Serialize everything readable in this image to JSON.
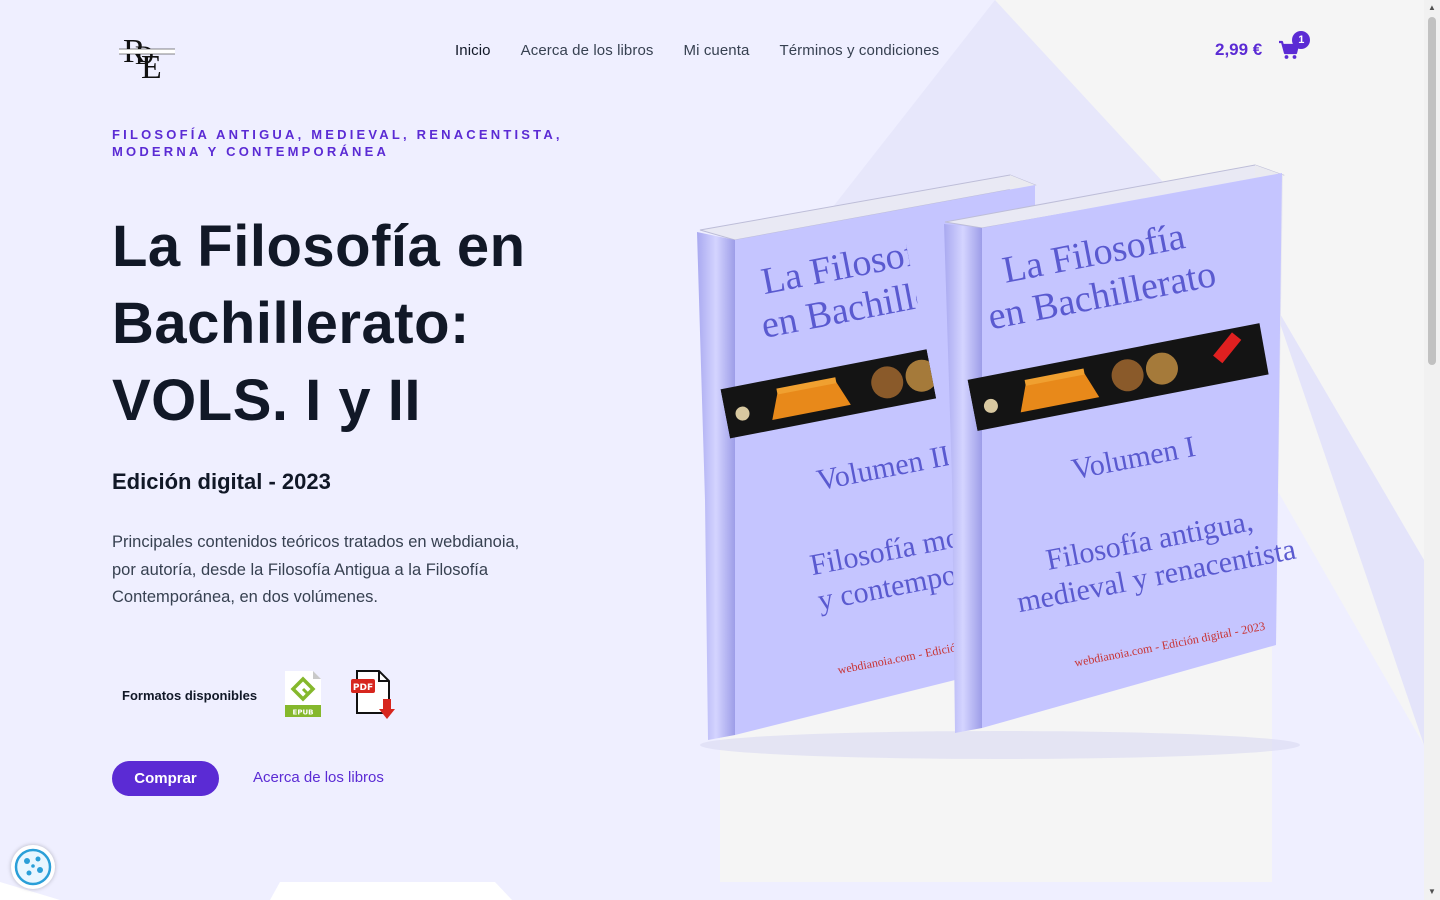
{
  "header": {
    "nav": [
      {
        "label": "Inicio",
        "active": true
      },
      {
        "label": "Acerca de los libros",
        "active": false
      },
      {
        "label": "Mi cuenta",
        "active": false
      },
      {
        "label": "Términos y condiciones",
        "active": false
      }
    ],
    "cart": {
      "total": "2,99 €",
      "count": "1",
      "icon": "cart-icon"
    },
    "logo": {
      "icon": "publisher-logo",
      "text": "RDE"
    }
  },
  "hero": {
    "eyebrow": "FILOSOFÍA ANTIGUA, MEDIEVAL, RENACENTISTA, MODERNA Y CONTEMPORÁNEA",
    "title_line1": "La Filosofía en",
    "title_line2": "Bachillerato:",
    "title_line3": "VOLS. I y II",
    "subtitle": "Edición digital - 2023",
    "description": "Principales contenidos teóricos tratados en webdianoia, por autoría, desde la Filosofía Antigua a la Filosofía Contemporánea, en dos volúmenes.",
    "formats_label": "Formatos disponibles",
    "formats": [
      {
        "icon": "epub-icon",
        "label": "EPUB"
      },
      {
        "icon": "pdf-icon",
        "label": "PDF"
      }
    ],
    "buy_label": "Comprar",
    "about_label": "Acerca de los libros"
  },
  "books": {
    "vol2": {
      "title_line1": "La Filosofí",
      "title_line2": "en Bachiller",
      "volume": "Volumen II",
      "topic_line1": "Filosofía mode",
      "topic_line2": "y contemporán",
      "footer": "webdianoia.com - Edición digital -"
    },
    "vol1": {
      "title_line1": "La Filosofía",
      "title_line2": "en Bachillerato",
      "volume": "Volumen I",
      "topic_line1": "Filosofía antigua,",
      "topic_line2": "medieval y renacentista",
      "footer": "webdianoia.com - Edición digital - 2023"
    }
  },
  "colors": {
    "accent": "#5b2bd4",
    "background": "#efefff",
    "book": "#c5c5ff"
  },
  "cookie": {
    "icon": "cookie-icon"
  }
}
